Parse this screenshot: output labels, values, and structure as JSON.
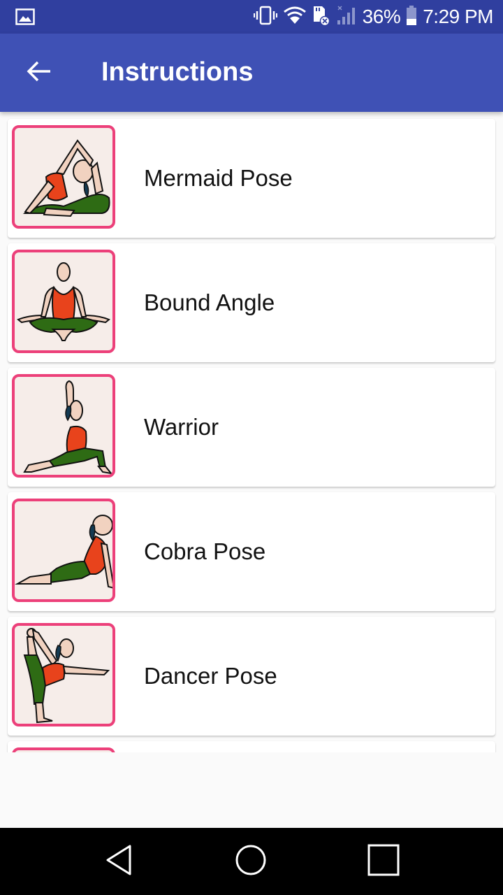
{
  "status_bar": {
    "notification_icon": "image-icon",
    "icons": [
      "vibrate-icon",
      "wifi-icon",
      "sd-card-error-icon",
      "signal-icon"
    ],
    "battery_percent": "36%",
    "battery_level": 0.36,
    "time": "7:29 PM"
  },
  "app_bar": {
    "back_icon": "arrow-back-icon",
    "title": "Instructions",
    "color": "#3f51b5"
  },
  "poses": [
    {
      "label": "Mermaid Pose",
      "icon": "mermaid-pose-illustration"
    },
    {
      "label": "Bound Angle",
      "icon": "bound-angle-illustration"
    },
    {
      "label": "Warrior",
      "icon": "warrior-illustration"
    },
    {
      "label": "Cobra Pose",
      "icon": "cobra-pose-illustration"
    },
    {
      "label": "Dancer Pose",
      "icon": "dancer-pose-illustration"
    },
    {
      "label": "",
      "icon": "pose-illustration"
    }
  ],
  "accent_color": "#ec407a",
  "nav_bar": {
    "back": "nav-back-icon",
    "home": "nav-home-icon",
    "recents": "nav-recents-icon"
  }
}
